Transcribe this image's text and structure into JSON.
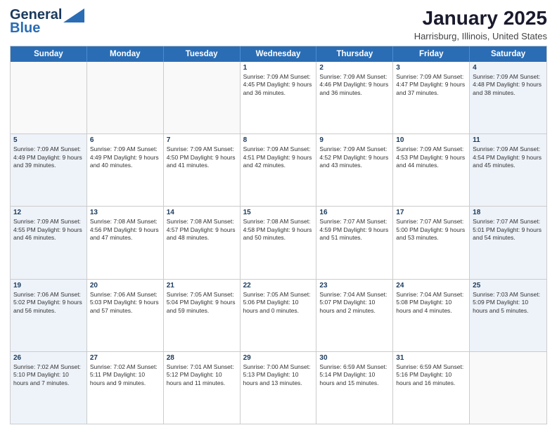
{
  "logo": {
    "line1": "General",
    "line2": "Blue"
  },
  "title": "January 2025",
  "subtitle": "Harrisburg, Illinois, United States",
  "dayHeaders": [
    "Sunday",
    "Monday",
    "Tuesday",
    "Wednesday",
    "Thursday",
    "Friday",
    "Saturday"
  ],
  "weeks": [
    [
      {
        "day": "",
        "info": "",
        "empty": true,
        "weekend": true
      },
      {
        "day": "",
        "info": "",
        "empty": true,
        "weekend": false
      },
      {
        "day": "",
        "info": "",
        "empty": true,
        "weekend": false
      },
      {
        "day": "1",
        "info": "Sunrise: 7:09 AM\nSunset: 4:45 PM\nDaylight: 9 hours\nand 36 minutes.",
        "empty": false,
        "weekend": false
      },
      {
        "day": "2",
        "info": "Sunrise: 7:09 AM\nSunset: 4:46 PM\nDaylight: 9 hours\nand 36 minutes.",
        "empty": false,
        "weekend": false
      },
      {
        "day": "3",
        "info": "Sunrise: 7:09 AM\nSunset: 4:47 PM\nDaylight: 9 hours\nand 37 minutes.",
        "empty": false,
        "weekend": false
      },
      {
        "day": "4",
        "info": "Sunrise: 7:09 AM\nSunset: 4:48 PM\nDaylight: 9 hours\nand 38 minutes.",
        "empty": false,
        "weekend": true
      }
    ],
    [
      {
        "day": "5",
        "info": "Sunrise: 7:09 AM\nSunset: 4:49 PM\nDaylight: 9 hours\nand 39 minutes.",
        "empty": false,
        "weekend": true
      },
      {
        "day": "6",
        "info": "Sunrise: 7:09 AM\nSunset: 4:49 PM\nDaylight: 9 hours\nand 40 minutes.",
        "empty": false,
        "weekend": false
      },
      {
        "day": "7",
        "info": "Sunrise: 7:09 AM\nSunset: 4:50 PM\nDaylight: 9 hours\nand 41 minutes.",
        "empty": false,
        "weekend": false
      },
      {
        "day": "8",
        "info": "Sunrise: 7:09 AM\nSunset: 4:51 PM\nDaylight: 9 hours\nand 42 minutes.",
        "empty": false,
        "weekend": false
      },
      {
        "day": "9",
        "info": "Sunrise: 7:09 AM\nSunset: 4:52 PM\nDaylight: 9 hours\nand 43 minutes.",
        "empty": false,
        "weekend": false
      },
      {
        "day": "10",
        "info": "Sunrise: 7:09 AM\nSunset: 4:53 PM\nDaylight: 9 hours\nand 44 minutes.",
        "empty": false,
        "weekend": false
      },
      {
        "day": "11",
        "info": "Sunrise: 7:09 AM\nSunset: 4:54 PM\nDaylight: 9 hours\nand 45 minutes.",
        "empty": false,
        "weekend": true
      }
    ],
    [
      {
        "day": "12",
        "info": "Sunrise: 7:09 AM\nSunset: 4:55 PM\nDaylight: 9 hours\nand 46 minutes.",
        "empty": false,
        "weekend": true
      },
      {
        "day": "13",
        "info": "Sunrise: 7:08 AM\nSunset: 4:56 PM\nDaylight: 9 hours\nand 47 minutes.",
        "empty": false,
        "weekend": false
      },
      {
        "day": "14",
        "info": "Sunrise: 7:08 AM\nSunset: 4:57 PM\nDaylight: 9 hours\nand 48 minutes.",
        "empty": false,
        "weekend": false
      },
      {
        "day": "15",
        "info": "Sunrise: 7:08 AM\nSunset: 4:58 PM\nDaylight: 9 hours\nand 50 minutes.",
        "empty": false,
        "weekend": false
      },
      {
        "day": "16",
        "info": "Sunrise: 7:07 AM\nSunset: 4:59 PM\nDaylight: 9 hours\nand 51 minutes.",
        "empty": false,
        "weekend": false
      },
      {
        "day": "17",
        "info": "Sunrise: 7:07 AM\nSunset: 5:00 PM\nDaylight: 9 hours\nand 53 minutes.",
        "empty": false,
        "weekend": false
      },
      {
        "day": "18",
        "info": "Sunrise: 7:07 AM\nSunset: 5:01 PM\nDaylight: 9 hours\nand 54 minutes.",
        "empty": false,
        "weekend": true
      }
    ],
    [
      {
        "day": "19",
        "info": "Sunrise: 7:06 AM\nSunset: 5:02 PM\nDaylight: 9 hours\nand 56 minutes.",
        "empty": false,
        "weekend": true
      },
      {
        "day": "20",
        "info": "Sunrise: 7:06 AM\nSunset: 5:03 PM\nDaylight: 9 hours\nand 57 minutes.",
        "empty": false,
        "weekend": false
      },
      {
        "day": "21",
        "info": "Sunrise: 7:05 AM\nSunset: 5:04 PM\nDaylight: 9 hours\nand 59 minutes.",
        "empty": false,
        "weekend": false
      },
      {
        "day": "22",
        "info": "Sunrise: 7:05 AM\nSunset: 5:06 PM\nDaylight: 10 hours\nand 0 minutes.",
        "empty": false,
        "weekend": false
      },
      {
        "day": "23",
        "info": "Sunrise: 7:04 AM\nSunset: 5:07 PM\nDaylight: 10 hours\nand 2 minutes.",
        "empty": false,
        "weekend": false
      },
      {
        "day": "24",
        "info": "Sunrise: 7:04 AM\nSunset: 5:08 PM\nDaylight: 10 hours\nand 4 minutes.",
        "empty": false,
        "weekend": false
      },
      {
        "day": "25",
        "info": "Sunrise: 7:03 AM\nSunset: 5:09 PM\nDaylight: 10 hours\nand 5 minutes.",
        "empty": false,
        "weekend": true
      }
    ],
    [
      {
        "day": "26",
        "info": "Sunrise: 7:02 AM\nSunset: 5:10 PM\nDaylight: 10 hours\nand 7 minutes.",
        "empty": false,
        "weekend": true
      },
      {
        "day": "27",
        "info": "Sunrise: 7:02 AM\nSunset: 5:11 PM\nDaylight: 10 hours\nand 9 minutes.",
        "empty": false,
        "weekend": false
      },
      {
        "day": "28",
        "info": "Sunrise: 7:01 AM\nSunset: 5:12 PM\nDaylight: 10 hours\nand 11 minutes.",
        "empty": false,
        "weekend": false
      },
      {
        "day": "29",
        "info": "Sunrise: 7:00 AM\nSunset: 5:13 PM\nDaylight: 10 hours\nand 13 minutes.",
        "empty": false,
        "weekend": false
      },
      {
        "day": "30",
        "info": "Sunrise: 6:59 AM\nSunset: 5:14 PM\nDaylight: 10 hours\nand 15 minutes.",
        "empty": false,
        "weekend": false
      },
      {
        "day": "31",
        "info": "Sunrise: 6:59 AM\nSunset: 5:16 PM\nDaylight: 10 hours\nand 16 minutes.",
        "empty": false,
        "weekend": false
      },
      {
        "day": "",
        "info": "",
        "empty": true,
        "weekend": true
      }
    ]
  ]
}
